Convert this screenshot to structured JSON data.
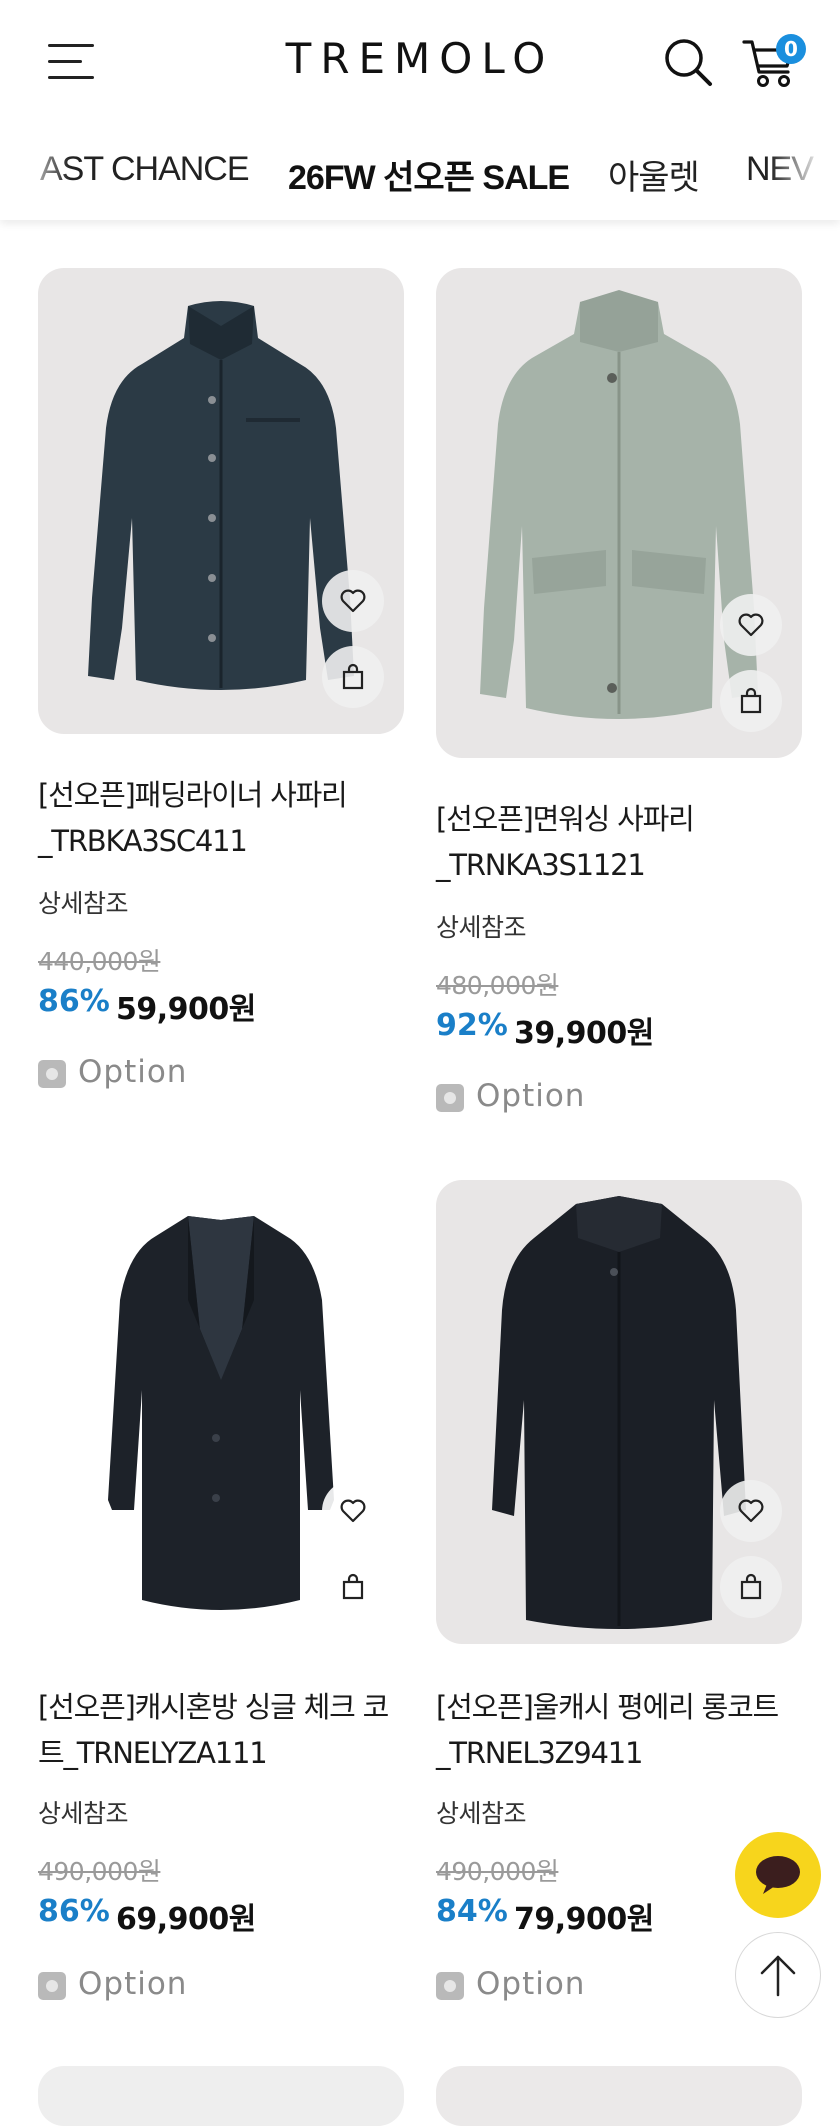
{
  "header": {
    "logo": "TREMOLO",
    "cart_count": "0"
  },
  "nav": {
    "items": [
      "AST CHANCE",
      "26FW 선오픈 SALE",
      "아울렛",
      "NEV"
    ]
  },
  "products": [
    {
      "name_line1": "[선오픈]패딩라이너 사파리",
      "name_line2": "_TRBKA3SC411",
      "detail": "상세참조",
      "original_price": "440,000원",
      "discount": "86%",
      "price": "59,900원",
      "option_label": "Option",
      "color": "#2b3a45"
    },
    {
      "name_line1": "[선오픈]면워싱 사파리",
      "name_line2": "_TRNKA3S1121",
      "detail": "상세참조",
      "original_price": "480,000원",
      "discount": "92%",
      "price": "39,900원",
      "option_label": "Option",
      "color": "#a6b3a9"
    },
    {
      "name_line1": "[선오픈]캐시혼방 싱글 체크 코",
      "name_line2": "트_TRNELYZA111",
      "detail": "상세참조",
      "original_price": "490,000원",
      "discount": "86%",
      "price": "69,900원",
      "option_label": "Option",
      "color": "#1d2229"
    },
    {
      "name_line1": "[선오픈]울캐시 평에리 롱코트",
      "name_line2": "_TRNEL3Z9411",
      "detail": "상세참조",
      "original_price": "490,000원",
      "discount": "84%",
      "price": "79,900원",
      "option_label": "Option",
      "color": "#1b1f26"
    }
  ],
  "icons": {
    "menu": "hamburger-icon",
    "search": "search-icon",
    "cart": "cart-icon",
    "wishlist": "heart-icon",
    "add_to_cart": "shopping-bag-icon",
    "chat": "chat-bubble-icon",
    "scroll_top": "arrow-up-icon"
  },
  "colors": {
    "accent_blue": "#1a7fc8",
    "badge_blue": "#1a8fde",
    "chat_yellow": "#f7d51c"
  }
}
